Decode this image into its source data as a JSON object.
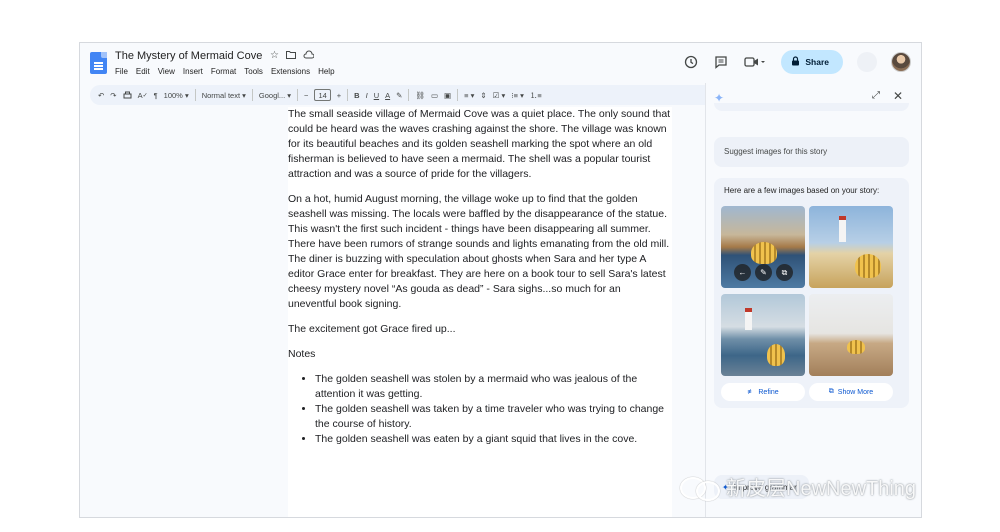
{
  "doc": {
    "title": "The Mystery of Mermaid Cove",
    "menu": [
      "File",
      "Edit",
      "View",
      "Insert",
      "Format",
      "Tools",
      "Extensions",
      "Help"
    ],
    "share_label": "Share"
  },
  "toolbar": {
    "zoom": "100%",
    "style": "Normal text",
    "font": "Googl...",
    "font_size": "14",
    "bold": "B",
    "italic": "I",
    "underline": "U",
    "text_color": "A",
    "minus": "−",
    "plus": "+"
  },
  "body": {
    "paragraphs": [
      "The small seaside village of Mermaid Cove was a quiet place. The only sound that could be heard was the waves crashing against the shore. The village was known for its beautiful beaches and its golden seashell marking the spot where an old fisherman is believed to have seen a mermaid. The shell was a popular tourist attraction and was a source of pride for the villagers.",
      "On a hot, humid August morning, the village woke up to find that the golden seashell was missing. The locals were baffled by the disappearance of the statue. This wasn't the first such incident - things have been disappearing all summer. There have been rumors of strange sounds and lights emanating from the old mill. The diner is buzzing with speculation about ghosts when Sara and her type A editor Grace enter for breakfast. They are here on a book tour to sell Sara's latest cheesy mystery novel “As gouda as dead” - Sara sighs...so much for an uneventful book signing.",
      "The excitement got Grace fired up...",
      "Notes"
    ],
    "notes": [
      "The golden seashell was stolen by a mermaid who was jealous of the attention it was getting.",
      "The golden seashell was taken by a time traveler who was trying to change the course of history.",
      "The golden seashell was eaten by a giant squid that lives in the cove."
    ]
  },
  "panel": {
    "prompt": "Suggest images for this story",
    "response_intro": "Here are a few images based on your story:",
    "refine_label": "Refine",
    "show_more_label": "Show More",
    "chip_label": "Improve grammar"
  },
  "watermark": "新皮层NewNewThing",
  "colors": {
    "share_bg": "#c2e7ff",
    "toolbar_bg": "#edf2fa",
    "accent_blue": "#0b57d0",
    "docs_blue": "#4285f4"
  },
  "icons": [
    "docs-logo-icon",
    "star-icon",
    "folder-move-icon",
    "cloud-status-icon",
    "history-icon",
    "comment-icon",
    "video-call-icon",
    "lock-icon",
    "undo-icon",
    "redo-icon",
    "print-icon",
    "spellcheck-icon",
    "paint-format-icon",
    "sparkle-icon",
    "expand-icon",
    "close-icon"
  ]
}
